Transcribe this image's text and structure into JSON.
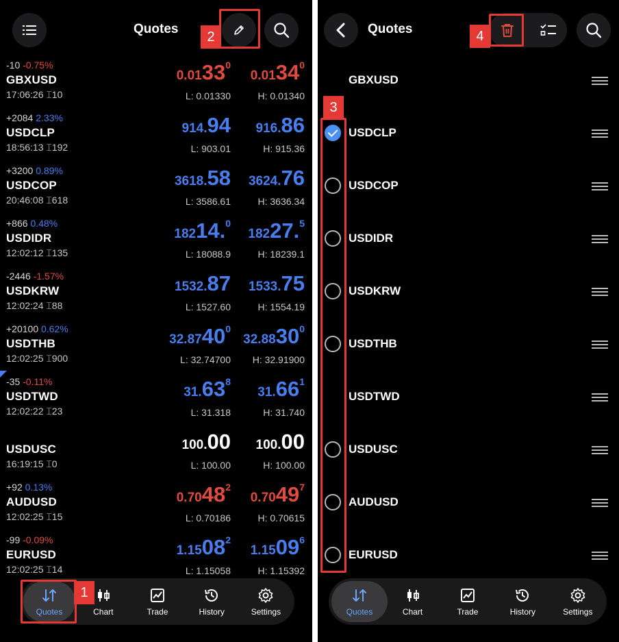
{
  "left": {
    "title": "Quotes",
    "quotes": [
      {
        "change_abs": "-10",
        "change_pct": "-0.75%",
        "pct_color": "red",
        "symbol": "GBXUSD",
        "time": "17:06:26 ⌶10",
        "bid_small": "0.01",
        "bid_big": "33",
        "bid_sup": "0",
        "ask_small": "0.01",
        "ask_big": "34",
        "ask_sup": "0",
        "price_color": "red",
        "low": "L: 0.01330",
        "high": "H: 0.01340"
      },
      {
        "change_abs": "+2084",
        "change_pct": "2.33%",
        "pct_color": "blue",
        "symbol": "USDCLP",
        "time": "18:56:13 ⌶192",
        "bid_small": "914.",
        "bid_big": "94",
        "bid_sup": "",
        "ask_small": "916.",
        "ask_big": "86",
        "ask_sup": "",
        "price_color": "blue",
        "low": "L: 903.01",
        "high": "H: 915.36"
      },
      {
        "change_abs": "+3200",
        "change_pct": "0.89%",
        "pct_color": "blue",
        "symbol": "USDCOP",
        "time": "20:46:08 ⌶618",
        "bid_small": "3618.",
        "bid_big": "58",
        "bid_sup": "",
        "ask_small": "3624.",
        "ask_big": "76",
        "ask_sup": "",
        "price_color": "blue",
        "low": "L: 3586.61",
        "high": "H: 3636.34"
      },
      {
        "change_abs": "+866",
        "change_pct": "0.48%",
        "pct_color": "blue",
        "symbol": "USDIDR",
        "time": "12:02:12 ⌶135",
        "bid_small": "182",
        "bid_big": "14.",
        "bid_sup": "0",
        "ask_small": "182",
        "ask_big": "27.",
        "ask_sup": "5",
        "price_color": "blue",
        "low": "L: 18088.9",
        "high": "H: 18239.1"
      },
      {
        "change_abs": "-2446",
        "change_pct": "-1.57%",
        "pct_color": "red",
        "symbol": "USDKRW",
        "time": "12:02:24 ⌶88",
        "bid_small": "1532.",
        "bid_big": "87",
        "bid_sup": "",
        "ask_small": "1533.",
        "ask_big": "75",
        "ask_sup": "",
        "price_color": "blue",
        "low": "L: 1527.60",
        "high": "H: 1554.19"
      },
      {
        "change_abs": "+20100",
        "change_pct": "0.62%",
        "pct_color": "blue",
        "symbol": "USDTHB",
        "time": "12:02:25 ⌶900",
        "bid_small": "32.87",
        "bid_big": "40",
        "bid_sup": "0",
        "ask_small": "32.88",
        "ask_big": "30",
        "ask_sup": "0",
        "price_color": "blue",
        "low": "L: 32.74700",
        "high": "H: 32.91900"
      },
      {
        "change_abs": "-35",
        "change_pct": "-0.11%",
        "pct_color": "red",
        "symbol": "USDTWD",
        "time": "12:02:22 ⌶23",
        "bid_small": "31.",
        "bid_big": "63",
        "bid_sup": "8",
        "ask_small": "31.",
        "ask_big": "66",
        "ask_sup": "1",
        "price_color": "blue",
        "low": "L: 31.318",
        "high": "H: 31.740"
      },
      {
        "change_abs": "",
        "change_pct": "",
        "pct_color": "blue",
        "symbol": "USDUSC",
        "time": "16:19:15 ⌶0",
        "bid_small": "100.",
        "bid_big": "00",
        "bid_sup": "",
        "ask_small": "100.",
        "ask_big": "00",
        "ask_sup": "",
        "price_color": "white",
        "low": "L: 100.00",
        "high": "H: 100.00"
      },
      {
        "change_abs": "+92",
        "change_pct": "0.13%",
        "pct_color": "blue",
        "symbol": "AUDUSD",
        "time": "12:02:25 ⌶15",
        "bid_small": "0.70",
        "bid_big": "48",
        "bid_sup": "2",
        "ask_small": "0.70",
        "ask_big": "49",
        "ask_sup": "7",
        "price_color": "red",
        "low": "L: 0.70186",
        "high": "H: 0.70615"
      },
      {
        "change_abs": "-99",
        "change_pct": "-0.09%",
        "pct_color": "red",
        "symbol": "EURUSD",
        "time": "12:02:25 ⌶14",
        "bid_small": "1.15",
        "bid_big": "08",
        "bid_sup": "2",
        "ask_small": "1.15",
        "ask_big": "09",
        "ask_sup": "6",
        "price_color": "blue",
        "low": "L: 1.15058",
        "high": "H: 1.15392"
      }
    ]
  },
  "right": {
    "title": "Quotes",
    "items": [
      {
        "symbol": "GBXUSD",
        "radio": "none"
      },
      {
        "symbol": "USDCLP",
        "radio": "checked"
      },
      {
        "symbol": "USDCOP",
        "radio": "empty"
      },
      {
        "symbol": "USDIDR",
        "radio": "empty"
      },
      {
        "symbol": "USDKRW",
        "radio": "empty"
      },
      {
        "symbol": "USDTHB",
        "radio": "empty"
      },
      {
        "symbol": "USDTWD",
        "radio": "none"
      },
      {
        "symbol": "USDUSC",
        "radio": "empty"
      },
      {
        "symbol": "AUDUSD",
        "radio": "empty"
      },
      {
        "symbol": "EURUSD",
        "radio": "empty"
      }
    ]
  },
  "nav": {
    "items": [
      {
        "label": "Quotes",
        "icon": "quotes-arrows-icon"
      },
      {
        "label": "Chart",
        "icon": "candlestick-icon"
      },
      {
        "label": "Trade",
        "icon": "trade-chart-icon"
      },
      {
        "label": "History",
        "icon": "history-clock-icon"
      },
      {
        "label": "Settings",
        "icon": "gear-icon"
      }
    ]
  },
  "annotations": {
    "b1": "1",
    "b2": "2",
    "b3": "3",
    "b4": "4"
  },
  "colors": {
    "red": "#e04b40",
    "blue": "#4a7eef",
    "annotation": "#e53935",
    "checked": "#4a90f5"
  }
}
